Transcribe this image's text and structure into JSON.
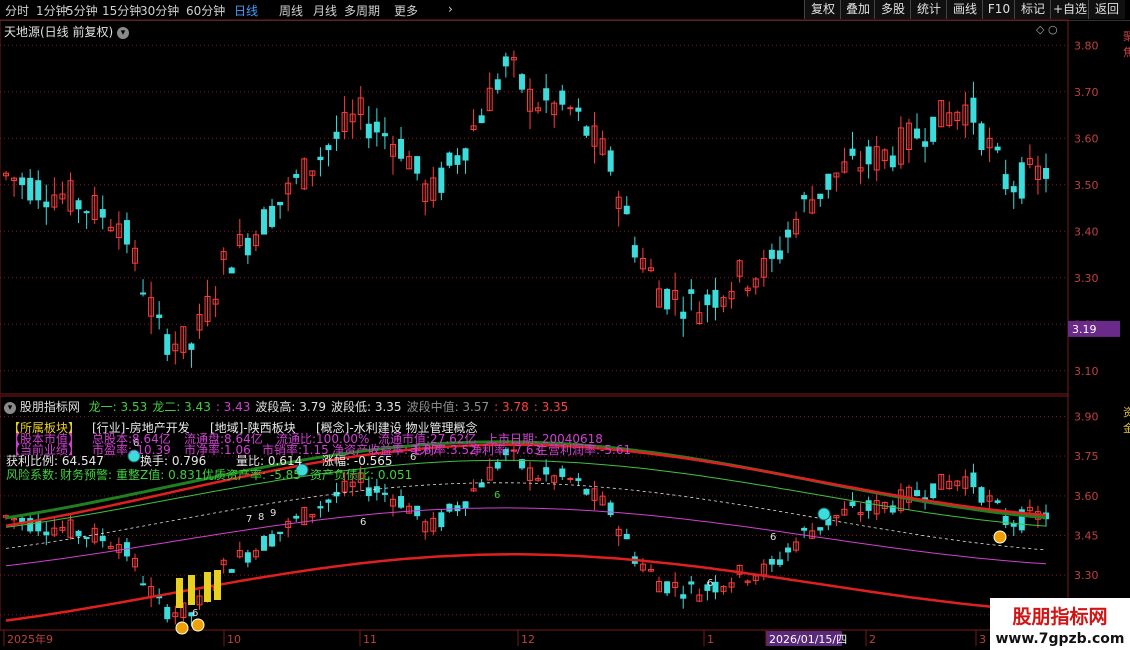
{
  "toolbar": {
    "periods": [
      "分时",
      "1分钟",
      "5分钟",
      "15分钟",
      "30分钟",
      "60分钟",
      "日线",
      "周线",
      "月线",
      "多周期",
      "更多"
    ],
    "active_period": "日线",
    "more_icon": "chevron-right-icon",
    "buttons": [
      "复权",
      "叠加",
      "多股",
      "统计",
      "画线",
      "F10",
      "标记",
      "+自选",
      "返回"
    ]
  },
  "main_chart": {
    "title": "天地源(日线 前复权)",
    "price_ticks": [
      "3.80",
      "3.70",
      "3.60",
      "3.50",
      "3.40",
      "3.30",
      "3.20",
      "3.10"
    ],
    "current_price": "3.19"
  },
  "indicator": {
    "name": "股朋指标网",
    "items": [
      {
        "label": "龙一:",
        "value": "3.53",
        "color": "#40d040"
      },
      {
        "label": "龙二:",
        "value": "3.43",
        "color": "#40d040"
      },
      {
        "label": ":",
        "value": "3.43",
        "color": "#d040d0"
      },
      {
        "label": "波段高:",
        "value": "3.79",
        "color": "#e0e0e0"
      },
      {
        "label": "波段低:",
        "value": "3.35",
        "color": "#e0e0e0"
      },
      {
        "label": "波段中值:",
        "value": "3.57",
        "color": "#909090"
      },
      {
        "label": ":",
        "value": "3.78",
        "color": "#ff4040"
      },
      {
        "label": ":",
        "value": "3.35",
        "color": "#ff4040"
      }
    ],
    "ticks": [
      "3.90",
      "3.75",
      "3.60",
      "3.45",
      "3.30",
      "3.15"
    ],
    "info_line1": [
      "【所属板块】",
      "[行业]-房地产开发",
      "[地域]-陕西板块",
      "[概念]-水利建设 物业管理概念"
    ],
    "info_line2": [
      "【股本市值】",
      "总股本:8.64亿",
      "流通盘:8.64亿",
      "流通比:100.00%",
      "流通市值:27.62亿",
      "上市日期: 20040618"
    ],
    "info_line3": [
      "【当前业绩】",
      "市盈率:-10.39",
      "市净率:1.06",
      "市销率:1.15",
      "净资产收益率:-1.87",
      "毛利率:3.52",
      "净利率:-7.63",
      "主营利润率:-5.61"
    ],
    "profit_ratio": "获利比例: 64.547",
    "turnover": "换手: 0.796",
    "volume_ratio": "量比: 0.614",
    "change": "涨幅: -0.565",
    "risk_line": [
      "风险系数:",
      "财务预警:",
      "重整Z值: 0.831",
      "优质资产率: -5.85",
      "资产负债比: 0.051"
    ],
    "annotations": [
      "6",
      "6",
      "7",
      "8",
      "9",
      "6",
      "6",
      "6",
      "6",
      "6"
    ]
  },
  "time_axis": {
    "labels": [
      "2025年9",
      "10",
      "11",
      "12",
      "1",
      "2026/01/15/四",
      "2",
      "3"
    ]
  },
  "side_labels": {
    "main": "聚焦",
    "indicator": "资金",
    "watermark_char": "买"
  },
  "watermark": {
    "title": "股朋指标网",
    "url": "www.7gpzb.com"
  },
  "colors": {
    "up": "#ff3c3c",
    "down": "#3cdcdc",
    "accent": "#3fa0ff",
    "grid": "#7a1a1a"
  }
}
